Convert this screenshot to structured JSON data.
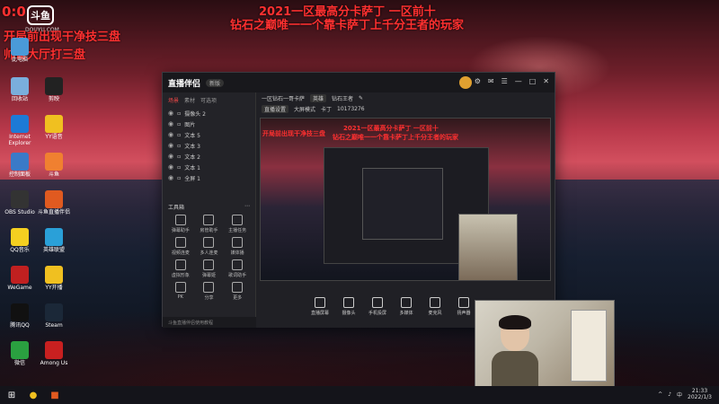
{
  "overlay": {
    "logo_text": "斗鱼",
    "logo_url": "DOUYU.COM",
    "number": "0:0",
    "header_line1": "2021一区最高分卡萨丁 一区前十",
    "header_line2": "钻石之巅唯一一个靠卡萨丁上千分王者的玩家",
    "left_line1": "开局前出现干净技三盘",
    "left_line2": "帅哥大厅打三盘"
  },
  "desktop_icons": [
    {
      "label": "此电脑",
      "icon": "computer-icon",
      "color": "#4a9ad8"
    },
    {
      "label": "回收站",
      "icon": "recycle-bin-icon",
      "color": "#7aaedc"
    },
    {
      "label": "剪映",
      "icon": "capcut-icon",
      "color": "#222"
    },
    {
      "label": "Internet Explorer",
      "icon": "ie-icon",
      "color": "#1d7ad6"
    },
    {
      "label": "YY语音",
      "icon": "yy-icon",
      "color": "#f0c020"
    },
    {
      "label": "控制面板",
      "icon": "control-panel-icon",
      "color": "#3a7ac8"
    },
    {
      "label": "斗鱼",
      "icon": "douyu-icon",
      "color": "#f08030"
    },
    {
      "label": "OBS Studio",
      "icon": "obs-icon",
      "color": "#333"
    },
    {
      "label": "斗鱼直播伴侣",
      "icon": "douyu-companion-icon",
      "color": "#e05a20"
    },
    {
      "label": "QQ音乐",
      "icon": "qqmusic-icon",
      "color": "#f5d020"
    },
    {
      "label": "英雄联盟",
      "icon": "lol-icon",
      "color": "#2aa0d8"
    },
    {
      "label": "WeGame",
      "icon": "wegame-icon",
      "color": "#c02020"
    },
    {
      "label": "YY开播",
      "icon": "yy-live-icon",
      "color": "#f0c020"
    },
    {
      "label": "腾讯QQ",
      "icon": "qq-icon",
      "color": "#111"
    },
    {
      "label": "Steam",
      "icon": "steam-icon",
      "color": "#1b2838"
    },
    {
      "label": "微信",
      "icon": "wechat-icon",
      "color": "#2aa040"
    },
    {
      "label": "Among Us",
      "icon": "among-us-icon",
      "color": "#c82020"
    }
  ],
  "app": {
    "logo": "直播伴侣",
    "version": "新版",
    "tabs": [
      "场景",
      "素材",
      "可选项"
    ],
    "sources": [
      "摄像头 2",
      "图片",
      "文本 5",
      "文本 3",
      "文本 2",
      "文本 1",
      "全屏 1"
    ],
    "tools_title": "工具箱",
    "tools": [
      "弹幕助手",
      "房管助手",
      "主播任务",
      "视频连麦",
      "多人连麦",
      "媒体播",
      "虚拟形象",
      "弹幕姬",
      "歌词助手",
      "PK",
      "分享",
      "更多"
    ],
    "tip": "斗鱼直播伴侣使用教程",
    "info": {
      "room_title": "一区钻石一哥卡萨",
      "category": "英雄",
      "tag": "钻石王者",
      "room_line": "直播设置",
      "stream": "大屏模式",
      "owner": "卡丁",
      "room_id": "10173276"
    },
    "bottom": [
      "直播屏幕",
      "摄像头",
      "手机投屏",
      "多媒体",
      "麦克风",
      "扬声器"
    ]
  },
  "taskbar": {
    "time": "21:33",
    "date": "2022/1/3",
    "lang": "中"
  }
}
